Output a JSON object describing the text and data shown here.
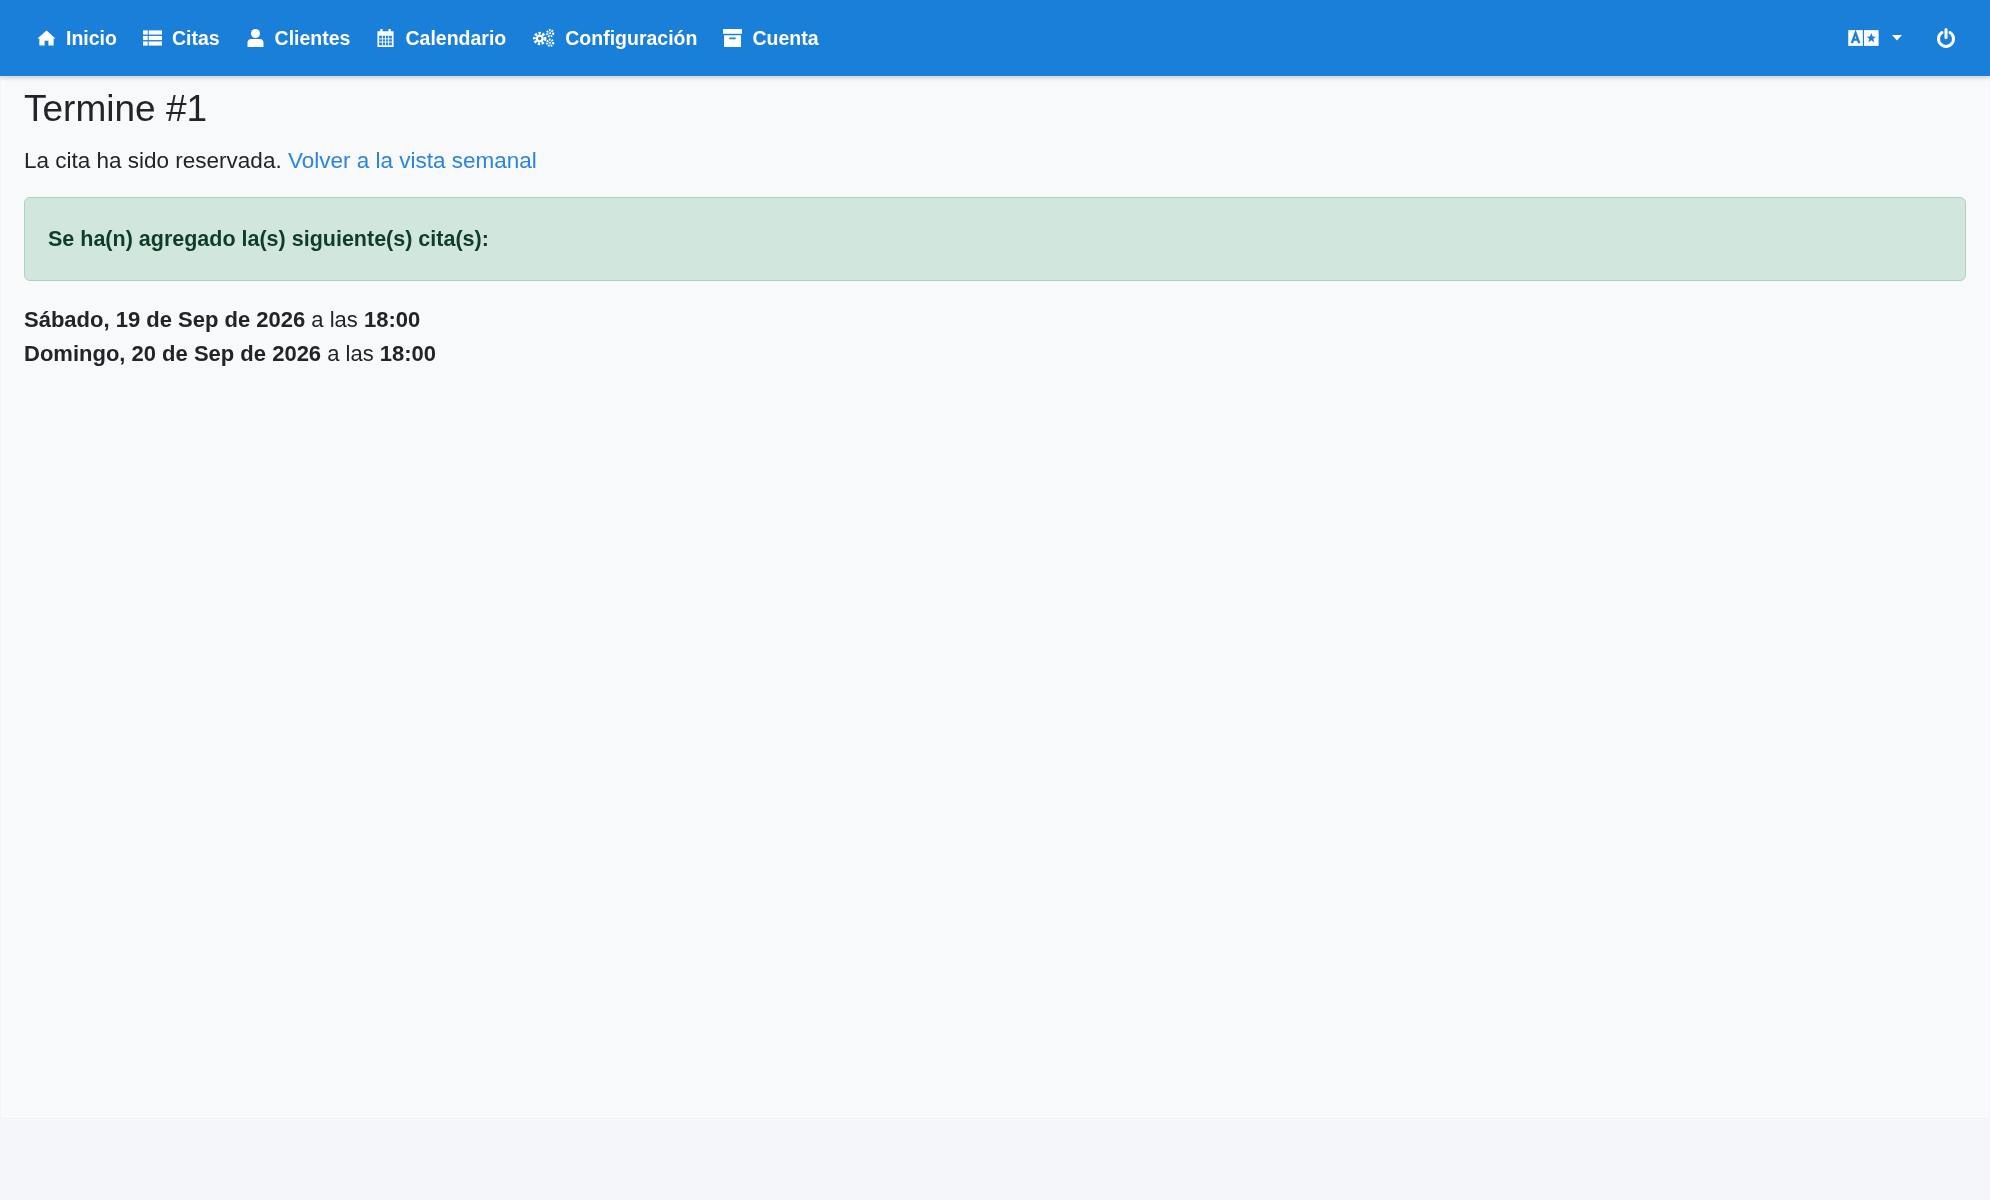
{
  "navbar": {
    "items": [
      {
        "label": "Inicio"
      },
      {
        "label": "Citas"
      },
      {
        "label": "Clientes"
      },
      {
        "label": "Calendario"
      },
      {
        "label": "Configuración"
      },
      {
        "label": "Cuenta"
      }
    ]
  },
  "page": {
    "title": "Termine #1",
    "message": "La cita ha sido reservada.",
    "link": "Volver a la vista semanal"
  },
  "alert": {
    "text": "Se ha(n) agregado la(s) siguiente(s) cita(s):"
  },
  "appointments": [
    {
      "text": "**Sábado, 19 de Sep de 2026** a las **18:00**"
    },
    {
      "text": "**Domingo, 20 de Sep de 2026** a las **18:00**"
    }
  ]
}
